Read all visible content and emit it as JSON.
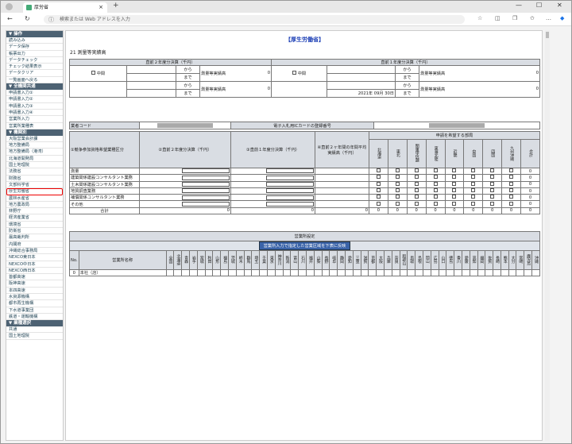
{
  "browser": {
    "tab_title": "厚労省",
    "address_placeholder": "検索または Web アドレスを入力"
  },
  "sidebar": {
    "sections": [
      {
        "title": "▼ 操作",
        "items": [
          "読み込み",
          "データ保存",
          "帳票出力",
          "データチェック",
          "チェック結果表示",
          "データクリア",
          "一覧画面へ戻る"
        ]
      },
      {
        "title": "▼ 全機関共通",
        "items": [
          "申請書入力①",
          "申請書入力②",
          "申請書入力③",
          "申請書入力④",
          "営業所入力",
          "営業所業種表"
        ]
      },
      {
        "title": "▼ 機関別",
        "items": [
          "大阪営業会計課",
          "地方整備局",
          "地方整備局（港湾）",
          "北海道開発局",
          "国土地理院",
          "法務省",
          "財務省",
          "文部科学省",
          "厚生労働省",
          "農林水産省",
          "地方農政局",
          "林野庁",
          "経済産業省",
          "環境省",
          "防衛省",
          "最高裁判所",
          "内閣府",
          "沖縄総合事務局",
          "NEXCO東日本",
          "NEXCO中日本",
          "NEXCO西日本",
          "首都高速",
          "阪神高速",
          "本四高速",
          "水資源機構",
          "都市再生機構",
          "下水道事業団",
          "鉄道・運輸機構"
        ]
      },
      {
        "title": "▼ 業種選択",
        "items": [
          "共通",
          "国土地理院"
        ]
      }
    ],
    "highlighted": "厚生労働省"
  },
  "main": {
    "org_title": "【厚生労働省】",
    "subtitle": "21 測量等実績高",
    "settle": {
      "prev2_header": "直前２年度分決算（千円）",
      "prev1_header": "直前１年度分決算（千円）",
      "mid_label": "中間",
      "kara": "から",
      "made": "まで",
      "jisseki": "測量等実績高",
      "zero": "0",
      "date_label": "2021年 09月 30日"
    },
    "company": {
      "code_label": "業者コード",
      "ic_label": "電子入札用ICカードの登録番号"
    },
    "grid": {
      "col1": "①競争参加資格希望業種区分",
      "col2": "②直前２年度分決算（千円）",
      "col3": "③直前１年度分決算（千円）",
      "col4": "④直前２ヶ年間の年間平均実績高（千円）",
      "region_header": "申請を希望する部局",
      "regions": [
        "北海道",
        "東北",
        "関東甲信越",
        "東海北陸",
        "近畿",
        "中国",
        "四国",
        "九州沖縄",
        "合計"
      ],
      "rows": [
        "測量",
        "建築関係建設コンサルタント業務",
        "土木関係建設コンサルタント業務",
        "地質調査業務",
        "補償関係コンサルタント業務",
        "その他",
        "合計"
      ],
      "zero": "0"
    },
    "office": {
      "title": "営業所設定",
      "button": "営業所入力で指定した営業区域を下表に反映",
      "no_label": "No.",
      "name_label": "営業所名称",
      "prefs": [
        "全国",
        "北海道",
        "青森",
        "岩手",
        "宮城",
        "秋田",
        "山形",
        "福島",
        "茨城",
        "栃木",
        "群馬",
        "埼玉",
        "千葉",
        "東京",
        "神奈川",
        "新潟",
        "富山",
        "石川",
        "福井",
        "山梨",
        "長野",
        "岐阜",
        "静岡",
        "愛知",
        "三重",
        "滋賀",
        "京都",
        "大阪",
        "兵庫",
        "奈良",
        "和歌山",
        "鳥取",
        "島根",
        "岡山",
        "広島",
        "山口",
        "徳島",
        "香川",
        "愛媛",
        "高知",
        "福岡",
        "佐賀",
        "長崎",
        "熊本",
        "大分",
        "宮崎",
        "鹿児島",
        "沖縄"
      ],
      "row_no": "0",
      "row_name": "本社（店）"
    }
  }
}
